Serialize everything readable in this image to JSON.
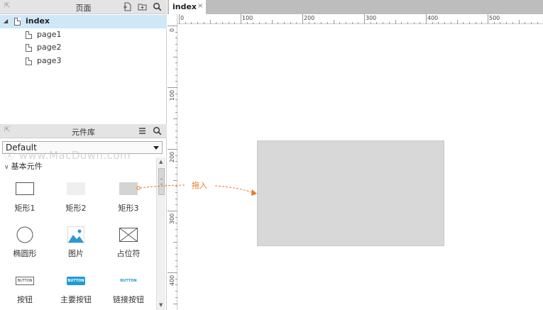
{
  "pages_panel": {
    "title": "页面",
    "items": [
      {
        "label": "index",
        "selected": true
      },
      {
        "label": "page1"
      },
      {
        "label": "page2"
      },
      {
        "label": "page3"
      }
    ]
  },
  "library_panel": {
    "title": "元件库",
    "library_select": "Default",
    "group_label": "基本元件",
    "widgets": [
      {
        "label": "矩形1",
        "icon": "rectangle-outline-icon"
      },
      {
        "label": "矩形2",
        "icon": "rectangle-light-icon"
      },
      {
        "label": "矩形3",
        "icon": "rectangle-gray-icon"
      },
      {
        "label": "椭圆形",
        "icon": "ellipse-icon"
      },
      {
        "label": "图片",
        "icon": "image-icon"
      },
      {
        "label": "占位符",
        "icon": "placeholder-icon"
      },
      {
        "label": "按钮",
        "icon": "button-icon",
        "icon_text": "BUTTON"
      },
      {
        "label": "主要按钮",
        "icon": "primary-button-icon",
        "icon_text": "BUTTON"
      },
      {
        "label": "链接按钮",
        "icon": "link-button-icon",
        "icon_text": "BUTTON"
      }
    ]
  },
  "watermark": "Ⓧ www.MacDown.com",
  "tab": {
    "label": "index",
    "close": "×"
  },
  "ruler": {
    "top_labels": [
      "0",
      "100",
      "200",
      "300",
      "400",
      "500"
    ],
    "left_labels": [
      "0",
      "100",
      "200",
      "300",
      "400"
    ]
  },
  "annotation": {
    "label": "拖入"
  },
  "colors": {
    "accent_orange": "#e87722",
    "selected_row": "#cfe8f8",
    "primary_button": "#1e9bd7"
  }
}
